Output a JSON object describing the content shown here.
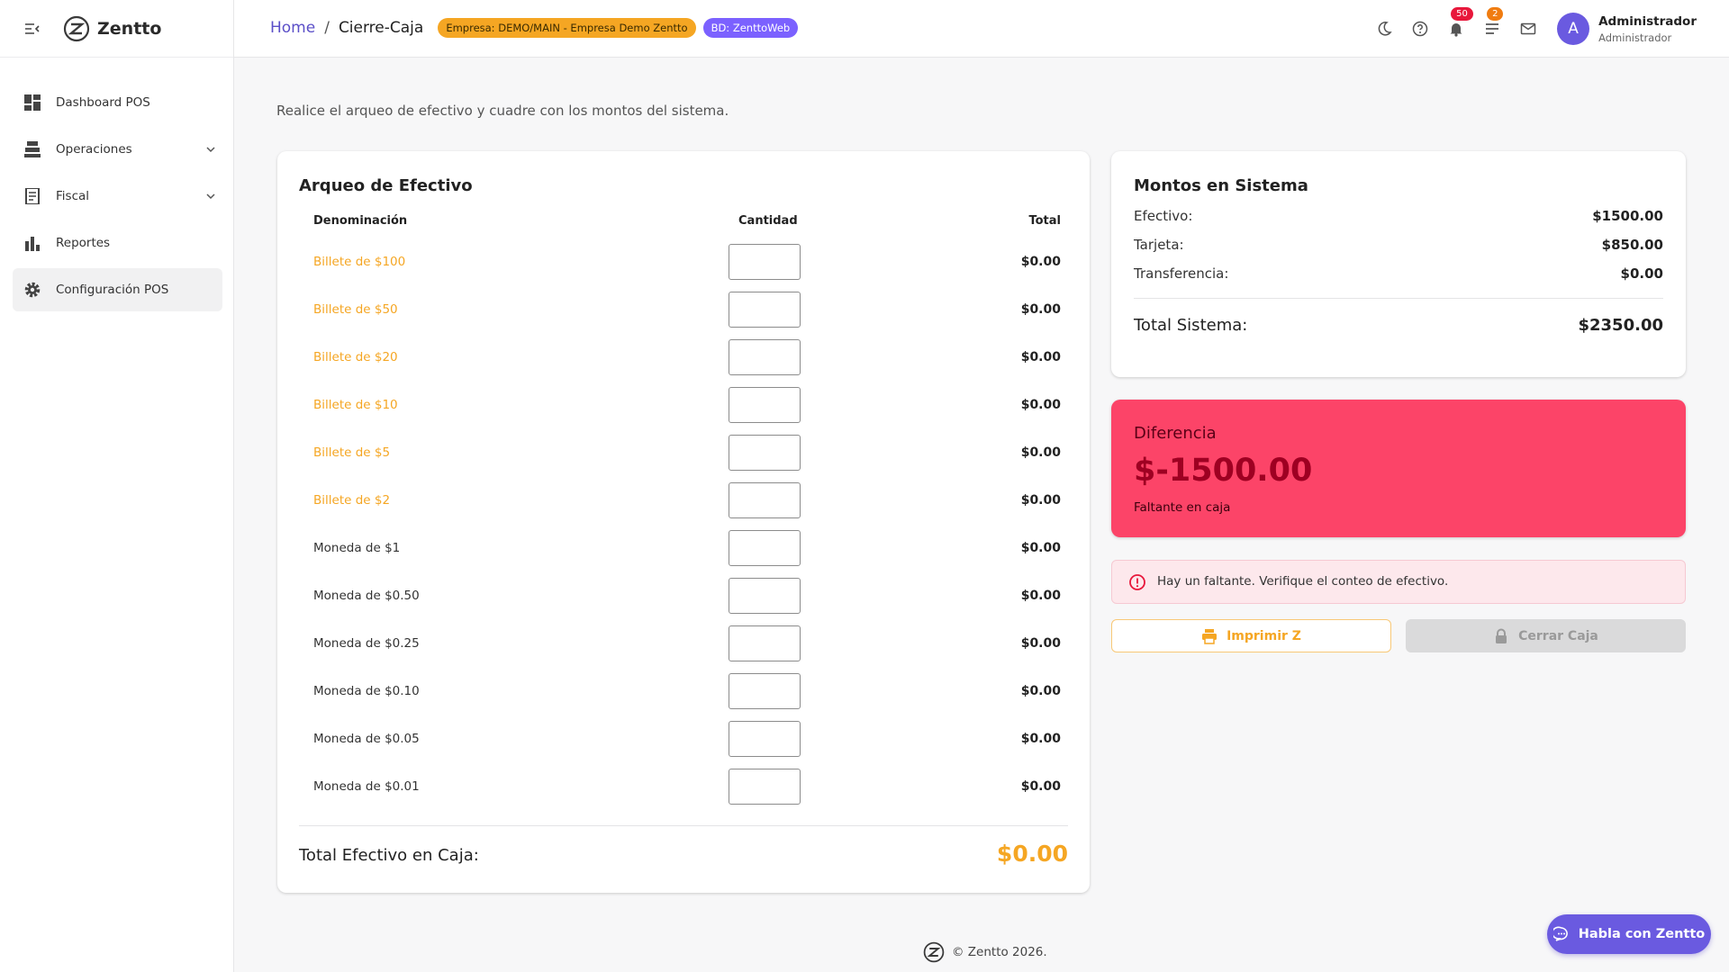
{
  "app": {
    "name": "Zentto"
  },
  "sidebar": {
    "items": [
      {
        "label": "Dashboard POS",
        "icon": "dashboard-icon"
      },
      {
        "label": "Operaciones",
        "icon": "register-icon"
      },
      {
        "label": "Fiscal",
        "icon": "receipt-icon"
      },
      {
        "label": "Reportes",
        "icon": "bar-chart-icon"
      },
      {
        "label": "Configuración POS",
        "icon": "gear-icon"
      }
    ]
  },
  "header": {
    "breadcrumb_home": "Home",
    "breadcrumb_sep": "/",
    "breadcrumb_current": "Cierre-Caja",
    "company_chip": "Empresa: DEMO/MAIN - Empresa Demo Zentto",
    "db_chip": "BD: ZenttoWeb",
    "notifications_count": "50",
    "tasks_count": "2",
    "avatar_letter": "A",
    "user_name": "Administrador",
    "user_role": "Administrador"
  },
  "main": {
    "subtitle": "Realice el arqueo de efectivo y cuadre con los montos del sistema.",
    "arqueo": {
      "title": "Arqueo de Efectivo",
      "col_denomination": "Denominación",
      "col_quantity": "Cantidad",
      "col_total": "Total",
      "rows": [
        {
          "label": "Billete de $100",
          "kind": "bill",
          "quantity": "",
          "total": "$0.00"
        },
        {
          "label": "Billete de $50",
          "kind": "bill",
          "quantity": "",
          "total": "$0.00"
        },
        {
          "label": "Billete de $20",
          "kind": "bill",
          "quantity": "",
          "total": "$0.00"
        },
        {
          "label": "Billete de $10",
          "kind": "bill",
          "quantity": "",
          "total": "$0.00"
        },
        {
          "label": "Billete de $5",
          "kind": "bill",
          "quantity": "",
          "total": "$0.00"
        },
        {
          "label": "Billete de $2",
          "kind": "bill",
          "quantity": "",
          "total": "$0.00"
        },
        {
          "label": "Moneda de $1",
          "kind": "coin",
          "quantity": "",
          "total": "$0.00"
        },
        {
          "label": "Moneda de $0.50",
          "kind": "coin",
          "quantity": "",
          "total": "$0.00"
        },
        {
          "label": "Moneda de $0.25",
          "kind": "coin",
          "quantity": "",
          "total": "$0.00"
        },
        {
          "label": "Moneda de $0.10",
          "kind": "coin",
          "quantity": "",
          "total": "$0.00"
        },
        {
          "label": "Moneda de $0.05",
          "kind": "coin",
          "quantity": "",
          "total": "$0.00"
        },
        {
          "label": "Moneda de $0.01",
          "kind": "coin",
          "quantity": "",
          "total": "$0.00"
        }
      ],
      "total_label": "Total Efectivo en Caja:",
      "total_value": "$0.00"
    },
    "system": {
      "title": "Montos en Sistema",
      "rows": [
        {
          "label": "Efectivo:",
          "value": "$1500.00"
        },
        {
          "label": "Tarjeta:",
          "value": "$850.00"
        },
        {
          "label": "Transferencia:",
          "value": "$0.00"
        }
      ],
      "total_label": "Total Sistema:",
      "total_value": "$2350.00"
    },
    "difference": {
      "title": "Diferencia",
      "value": "$-1500.00",
      "status": "Faltante en caja"
    },
    "alert": {
      "text": "Hay un faltante. Verifique el conteo de efectivo."
    },
    "actions": {
      "print_label": "Imprimir Z",
      "close_label": "Cerrar Caja"
    }
  },
  "footer": {
    "text": "© Zentto 2026."
  },
  "chat": {
    "label": "Habla con Zentto"
  },
  "colors": {
    "primary": "#6a5ae0",
    "accent": "#f5a623",
    "danger": "#fc4468",
    "badge_red": "#e8173b",
    "badge_orange": "#f07c10"
  }
}
